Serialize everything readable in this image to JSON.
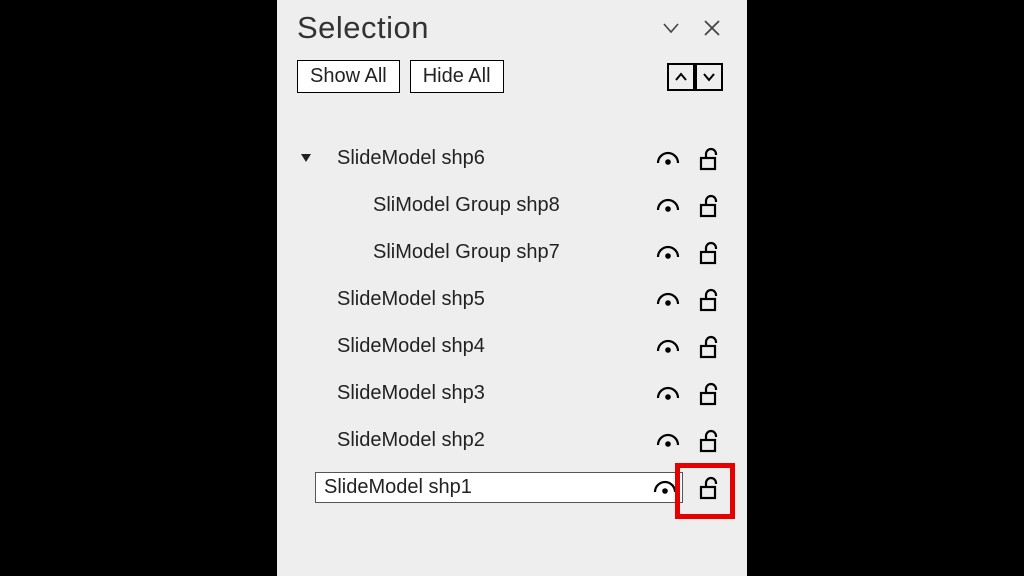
{
  "panel": {
    "title": "Selection",
    "show_all_label": "Show All",
    "hide_all_label": "Hide All"
  },
  "tree": {
    "items": [
      {
        "label": "SlideModel shp6",
        "indent": 1,
        "expanded": true,
        "hasChildren": true,
        "selected": false
      },
      {
        "label": "SliModel Group shp8",
        "indent": 2,
        "expanded": false,
        "hasChildren": false,
        "selected": false
      },
      {
        "label": "SliModel Group shp7",
        "indent": 2,
        "expanded": false,
        "hasChildren": false,
        "selected": false
      },
      {
        "label": "SlideModel shp5",
        "indent": 1,
        "expanded": false,
        "hasChildren": false,
        "selected": false
      },
      {
        "label": "SlideModel shp4",
        "indent": 1,
        "expanded": false,
        "hasChildren": false,
        "selected": false
      },
      {
        "label": "SlideModel shp3",
        "indent": 1,
        "expanded": false,
        "hasChildren": false,
        "selected": false
      },
      {
        "label": "SlideModel shp2",
        "indent": 1,
        "expanded": false,
        "hasChildren": false,
        "selected": false
      },
      {
        "label": "SlideModel shp1",
        "indent": 1,
        "expanded": false,
        "hasChildren": false,
        "selected": true
      }
    ]
  }
}
